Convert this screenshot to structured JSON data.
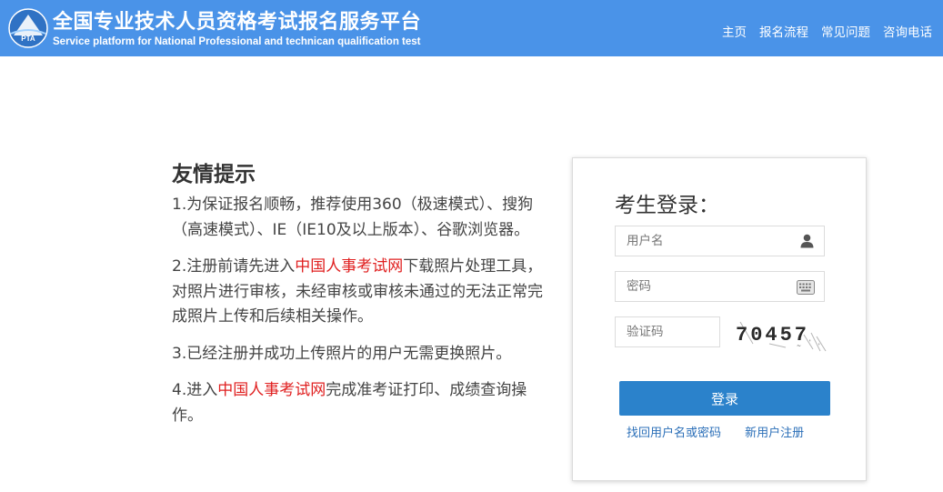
{
  "header": {
    "logo_text": "PTA",
    "title": "全国专业技术人员资格考试报名服务平台",
    "subtitle": "Service platform for National Professional and technican qualification test",
    "nav": [
      "主页",
      "报名流程",
      "常见问题",
      "咨询电话"
    ]
  },
  "tips": {
    "title": "友情提示",
    "items": [
      {
        "text": "1.为保证报名顺畅，推荐使用360（极速模式）、搜狗（高速模式）、IE（IE10及以上版本）、谷歌浏览器。"
      },
      {
        "before": "2.注册前请先进入",
        "link": "中国人事考试网",
        "after": "下载照片处理工具，对照片进行审核，未经审核或审核未通过的无法正常完成照片上传和后续相关操作。"
      },
      {
        "text": "3.已经注册并成功上传照片的用户无需更换照片。"
      },
      {
        "before": "4.进入",
        "link": "中国人事考试网",
        "after": "完成准考证打印、成绩查询操作。"
      }
    ]
  },
  "login": {
    "title": "考生登录：",
    "username_placeholder": "用户名",
    "password_placeholder": "密码",
    "captcha_placeholder": "验证码",
    "captcha_code": "70457",
    "submit_label": "登录",
    "forgot_link": "找回用户名或密码",
    "register_link": "新用户注册"
  },
  "colors": {
    "header_bg": "#4a93e8",
    "button_bg": "#2b82cb",
    "highlight_link": "#e02020",
    "link": "#2b6fb8"
  },
  "icons": [
    "pta-logo-icon",
    "user-icon",
    "keyboard-icon"
  ]
}
